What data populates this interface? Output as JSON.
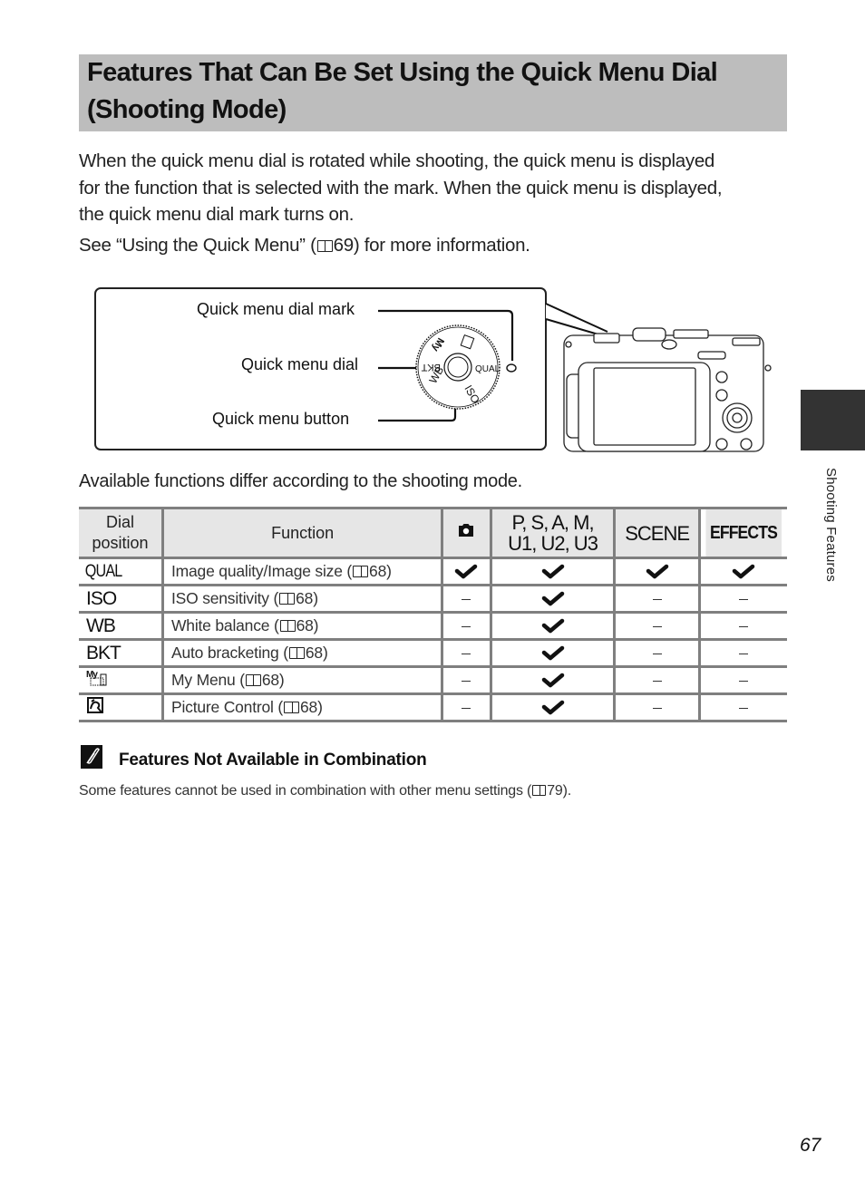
{
  "header": {
    "title_line1": "Features That Can Be Set Using the Quick Menu Dial",
    "title_line2": "(Shooting Mode)"
  },
  "intro": {
    "line1": "When the quick menu dial is rotated while shooting, the quick menu is displayed",
    "line2": "for the function that is selected with the mark. When the quick menu is displayed,",
    "line3": "the quick menu dial mark turns on.",
    "see_before": "See “Using the Quick Menu” (",
    "see_page": "69",
    "see_after": ") for more information."
  },
  "diagram": {
    "labels": {
      "dial_mark": "Quick menu dial mark",
      "dial": "Quick menu dial",
      "button": "Quick menu button"
    },
    "dial_positions": [
      "QUAL",
      "ISO",
      "WB",
      "BKT",
      "My",
      "PC"
    ]
  },
  "availability_note": "Available functions differ according to the shooting mode.",
  "table": {
    "headers": {
      "dial_line1": "Dial",
      "dial_line2": "position",
      "function": "Function",
      "auto_icon": "camera-icon",
      "psam_line1": "P, S, A, M,",
      "psam_line2": "U1, U2, U3",
      "scene": "SCENE",
      "effects": "EFFECTS"
    },
    "rows": [
      {
        "dial": "QUAL",
        "function": "Image quality/Image size (",
        "page": "68",
        "close": ")",
        "auto": "check",
        "psam": "check",
        "scene": "check",
        "effects": "check"
      },
      {
        "dial": "ISO",
        "function": "ISO sensitivity (",
        "page": "68",
        "close": ")",
        "auto": "dash",
        "psam": "check",
        "scene": "dash",
        "effects": "dash"
      },
      {
        "dial": "WB",
        "function": "White balance (",
        "page": "68",
        "close": ")",
        "auto": "dash",
        "psam": "check",
        "scene": "dash",
        "effects": "dash"
      },
      {
        "dial": "BKT",
        "function": "Auto bracketing (",
        "page": "68",
        "close": ")",
        "auto": "dash",
        "psam": "check",
        "scene": "dash",
        "effects": "dash"
      },
      {
        "dial": "my-menu-icon",
        "function": "My Menu (",
        "page": "68",
        "close": ")",
        "auto": "dash",
        "psam": "check",
        "scene": "dash",
        "effects": "dash"
      },
      {
        "dial": "picture-control-icon",
        "function": "Picture Control (",
        "page": "68",
        "close": ")",
        "auto": "dash",
        "psam": "check",
        "scene": "dash",
        "effects": "dash"
      }
    ]
  },
  "note": {
    "icon": "pencil-note-icon",
    "title": "Features Not Available in Combination",
    "body_before": "Some features cannot be used in combination with other menu settings (",
    "body_page": "79",
    "body_after": ")."
  },
  "sidebar": {
    "section_label": "Shooting Features"
  },
  "footer": {
    "page_number": "67"
  }
}
